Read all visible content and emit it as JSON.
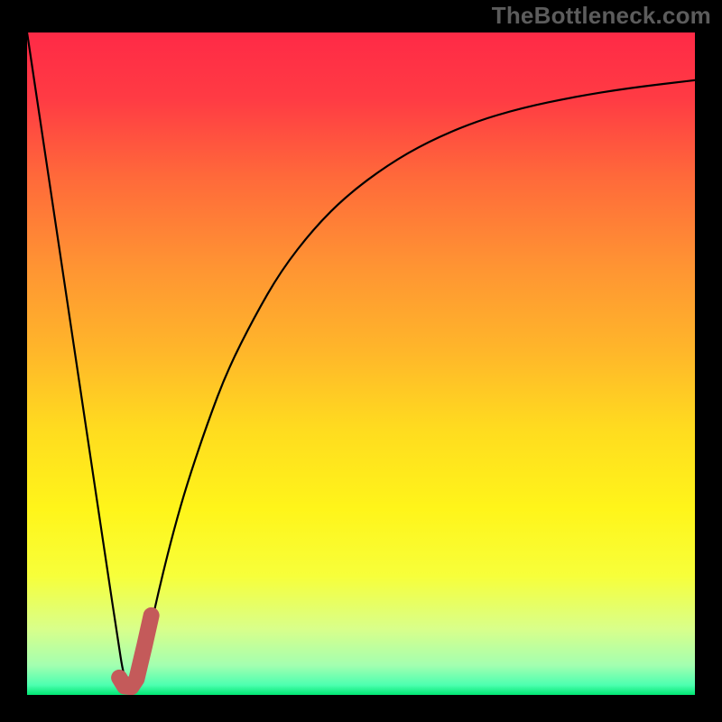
{
  "watermark": "TheBottleneck.com",
  "colors": {
    "frame_bg": "#000000",
    "curve_stroke": "#000000",
    "marker_stroke": "#c45a5a",
    "watermark_text": "#5c5c5c"
  },
  "chart_data": {
    "type": "line",
    "title": "",
    "xlabel": "",
    "ylabel": "",
    "xlim": [
      0,
      100
    ],
    "ylim": [
      0,
      100
    ],
    "grid": false,
    "legend": false,
    "background_gradient": [
      {
        "offset": 0.0,
        "color": "#ff2a46"
      },
      {
        "offset": 0.1,
        "color": "#ff3b44"
      },
      {
        "offset": 0.22,
        "color": "#ff6a3a"
      },
      {
        "offset": 0.35,
        "color": "#ff9333"
      },
      {
        "offset": 0.48,
        "color": "#ffb62a"
      },
      {
        "offset": 0.6,
        "color": "#ffdc1f"
      },
      {
        "offset": 0.72,
        "color": "#fff51a"
      },
      {
        "offset": 0.82,
        "color": "#f7ff3a"
      },
      {
        "offset": 0.9,
        "color": "#d9ff8a"
      },
      {
        "offset": 0.955,
        "color": "#a4ffb0"
      },
      {
        "offset": 0.985,
        "color": "#4dffb0"
      },
      {
        "offset": 1.0,
        "color": "#00e673"
      }
    ],
    "series": [
      {
        "name": "bottleneck-curve",
        "x": [
          0,
          2,
          4,
          6,
          8,
          10,
          12,
          13.5,
          14.5,
          15.5,
          16.5,
          18,
          20,
          22,
          24,
          27,
          30,
          34,
          38,
          43,
          48,
          54,
          60,
          67,
          74,
          82,
          90,
          100
        ],
        "y": [
          100,
          86.5,
          73,
          59.5,
          46,
          32.5,
          19,
          9,
          2.5,
          1.2,
          2.0,
          8,
          17,
          25,
          32,
          41,
          49,
          57,
          64,
          70.5,
          75.5,
          80,
          83.5,
          86.5,
          88.6,
          90.3,
          91.6,
          92.8
        ]
      }
    ],
    "marker": {
      "name": "sweet-spot",
      "points_xy": [
        [
          13.8,
          2.6
        ],
        [
          14.6,
          1.3
        ],
        [
          15.6,
          1.2
        ],
        [
          16.4,
          2.4
        ],
        [
          17.6,
          7.5
        ],
        [
          18.6,
          12.0
        ]
      ]
    }
  }
}
